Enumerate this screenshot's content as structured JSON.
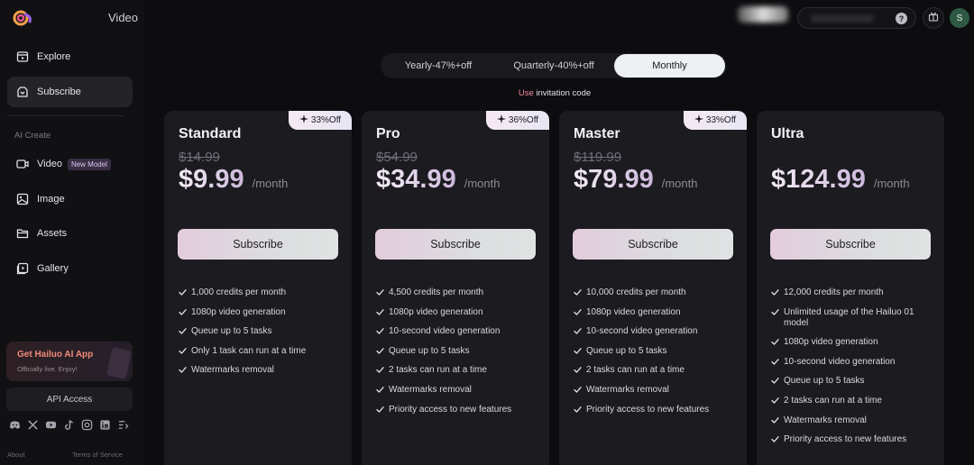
{
  "brand": {
    "product_label": "Video",
    "logo_icon": "hailuo-logo-icon"
  },
  "colors": {
    "accent_pink": "#f08a9a",
    "card_bg": "#1b1b20",
    "page_bg": "#0d0d10",
    "avatar_bg": "#2e5a45"
  },
  "sidebar": {
    "nav_top": [
      {
        "label": "Explore",
        "icon": "explore-icon"
      },
      {
        "label": "Subscribe",
        "icon": "subscribe-icon",
        "active": true
      }
    ],
    "section_label": "AI Create",
    "nav_create": [
      {
        "label": "Video",
        "icon": "video-icon",
        "badge": "New Model"
      },
      {
        "label": "Image",
        "icon": "image-icon"
      },
      {
        "label": "Assets",
        "icon": "folder-icon"
      },
      {
        "label": "Gallery",
        "icon": "gallery-icon"
      }
    ],
    "promo": {
      "title": "Get Hailuo AI App",
      "subtitle": "Officially live. Enjoy!"
    },
    "api_label": "API Access",
    "socials": [
      "discord-icon",
      "x-icon",
      "youtube-icon",
      "tiktok-icon",
      "instagram-icon",
      "linkedin-icon",
      "list-icon"
    ],
    "footer": {
      "about": "About",
      "terms": "Terms of Service"
    }
  },
  "header": {
    "help_glyph": "?",
    "avatar_initial": "S"
  },
  "billing": {
    "options": [
      {
        "label": "Yearly-47%+off"
      },
      {
        "label": "Quarterly-40%+off"
      },
      {
        "label": "Monthly",
        "selected": true
      }
    ],
    "invite_prefix": "Use",
    "invite_rest": " invitation code"
  },
  "plans": [
    {
      "name": "Standard",
      "discount": "33%Off",
      "old_price": "$14.99",
      "price": "$9.99",
      "per": "/month",
      "cta": "Subscribe",
      "features": [
        "1,000 credits per month",
        "1080p video generation",
        "Queue up to 5 tasks",
        "Only 1 task can run at a time",
        "Watermarks removal"
      ]
    },
    {
      "name": "Pro",
      "discount": "36%Off",
      "old_price": "$54.99",
      "price": "$34.99",
      "per": "/month",
      "cta": "Subscribe",
      "features": [
        "4,500 credits per month",
        "1080p video generation",
        "10-second video generation",
        "Queue up to 5 tasks",
        "2 tasks can run at a time",
        "Watermarks removal",
        "Priority access to new features"
      ]
    },
    {
      "name": "Master",
      "discount": "33%Off",
      "old_price": "$119.99",
      "price": "$79.99",
      "per": "/month",
      "cta": "Subscribe",
      "features": [
        "10,000 credits per month",
        "1080p video generation",
        "10-second video generation",
        "Queue up to 5 tasks",
        "2 tasks can run at a time",
        "Watermarks removal",
        "Priority access to new features"
      ]
    },
    {
      "name": "Ultra",
      "discount": "",
      "old_price": "",
      "price": "$124.99",
      "per": "/month",
      "cta": "Subscribe",
      "features": [
        "12,000 credits per month",
        "Unlimited usage of the Hailuo 01 model",
        "1080p video generation",
        "10-second video generation",
        "Queue up to 5 tasks",
        "2 tasks can run at a time",
        "Watermarks removal",
        "Priority access to new features"
      ]
    }
  ]
}
